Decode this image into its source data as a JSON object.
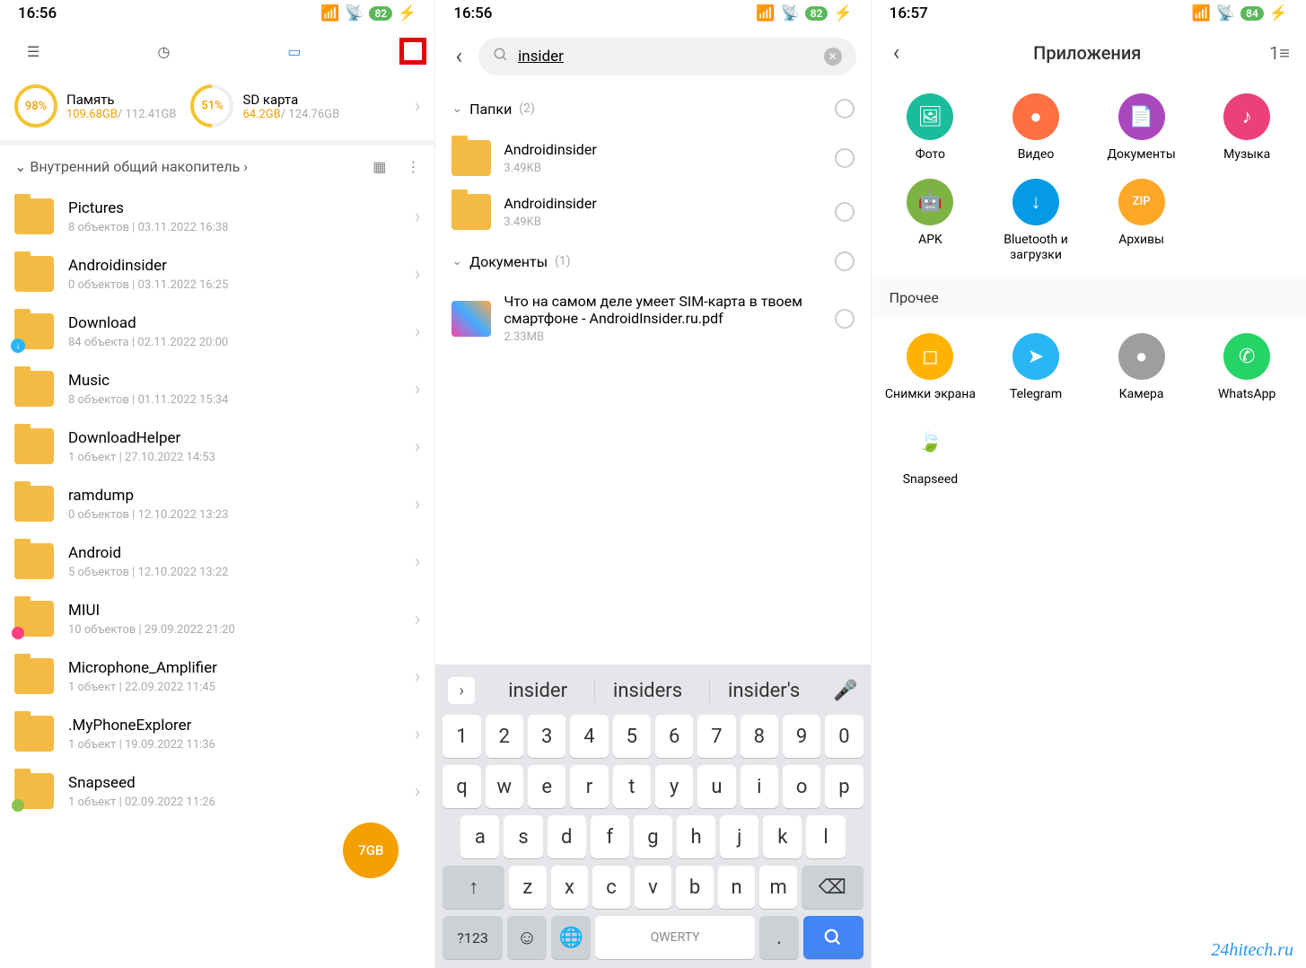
{
  "watermark": "24hitech.ru",
  "phone1": {
    "time": "16:56",
    "battery": "82",
    "storage": {
      "internal": {
        "percent": "98%",
        "label": "Память",
        "used": "109.68GB",
        "total": "/ 112.41GB"
      },
      "sd": {
        "percent": "51%",
        "label": "SD карта",
        "used": "64.2GB",
        "total": "/ 124.76GB"
      }
    },
    "path": "Внутренний общий накопитель",
    "files": [
      {
        "name": "Pictures",
        "meta": "8 объектов  |  03.11.2022 16:38",
        "badge": ""
      },
      {
        "name": "Androidinsider",
        "meta": "0 объектов  |  03.11.2022 16:25",
        "badge": ""
      },
      {
        "name": "Download",
        "meta": "84 объекта  |  02.11.2022 20:00",
        "badge": "blue"
      },
      {
        "name": "Music",
        "meta": "8 объектов  |  01.11.2022 15:34",
        "badge": ""
      },
      {
        "name": "DownloadHelper",
        "meta": "1 объект  |  27.10.2022 14:53",
        "badge": ""
      },
      {
        "name": "ramdump",
        "meta": "0 объектов  |  12.10.2022 13:23",
        "badge": ""
      },
      {
        "name": "Android",
        "meta": "5 объектов  |  12.10.2022 13:22",
        "badge": ""
      },
      {
        "name": "MIUI",
        "meta": "10 объектов  |  29.09.2022 21:20",
        "badge": "pink"
      },
      {
        "name": "Microphone_Amplifier",
        "meta": "1 объект  |  22.09.2022 11:45",
        "badge": ""
      },
      {
        "name": ".MyPhoneExplorer",
        "meta": "1 объект  |  19.09.2022 11:36",
        "badge": ""
      },
      {
        "name": "Snapseed",
        "meta": "1 объект  |  02.09.2022 11:26",
        "badge": "green"
      }
    ],
    "fab": "7GB"
  },
  "phone2": {
    "time": "16:56",
    "battery": "82",
    "search_query": "insider",
    "sections": {
      "folders": {
        "label": "Папки",
        "count": "(2)"
      },
      "documents": {
        "label": "Документы",
        "count": "(1)"
      }
    },
    "folder_results": [
      {
        "name": "Androidinsider",
        "size": "3.49KB"
      },
      {
        "name": "Androidinsider",
        "size": "3.49KB"
      }
    ],
    "doc_results": [
      {
        "name": "Что на самом деле умеет SIM-карта в твоем смартфоне - AndroidInsider.ru.pdf",
        "size": "2.33MB"
      }
    ],
    "suggestions": [
      "insider",
      "insiders",
      "insider's"
    ],
    "space_label": "QWERTY",
    "num_label": "?123",
    "kb_rows": {
      "r1": [
        "1",
        "2",
        "3",
        "4",
        "5",
        "6",
        "7",
        "8",
        "9",
        "0"
      ],
      "r2": [
        "q",
        "w",
        "e",
        "r",
        "t",
        "y",
        "u",
        "i",
        "o",
        "p"
      ],
      "r3": [
        "a",
        "s",
        "d",
        "f",
        "g",
        "h",
        "j",
        "k",
        "l"
      ],
      "r4": [
        "z",
        "x",
        "c",
        "v",
        "b",
        "n",
        "m"
      ]
    }
  },
  "phone3": {
    "time": "16:57",
    "battery": "84",
    "title": "Приложения",
    "section_other": "Прочее",
    "apps_top": [
      {
        "label": "Фото",
        "color": "#1abc9c",
        "icon": "🖼"
      },
      {
        "label": "Видео",
        "color": "#ff7043",
        "icon": "●"
      },
      {
        "label": "Документы",
        "color": "#ab47bc",
        "icon": "📄"
      },
      {
        "label": "Музыка",
        "color": "#ec407a",
        "icon": "♪"
      },
      {
        "label": "APK",
        "color": "#7cb342",
        "icon": "🤖"
      },
      {
        "label": "Bluetooth и загрузки",
        "color": "#039be5",
        "icon": "↓"
      },
      {
        "label": "Архивы",
        "color": "#ffa726",
        "icon": "ZIP"
      }
    ],
    "apps_other": [
      {
        "label": "Снимки экрана",
        "color": "#ffb300",
        "icon": "◻"
      },
      {
        "label": "Telegram",
        "color": "#29b6f6",
        "icon": "➤"
      },
      {
        "label": "Камера",
        "color": "#9e9e9e",
        "icon": "●"
      },
      {
        "label": "WhatsApp",
        "color": "#25d366",
        "icon": "✆"
      },
      {
        "label": "Snapseed",
        "color": "#fff",
        "icon": "🍃"
      }
    ]
  }
}
